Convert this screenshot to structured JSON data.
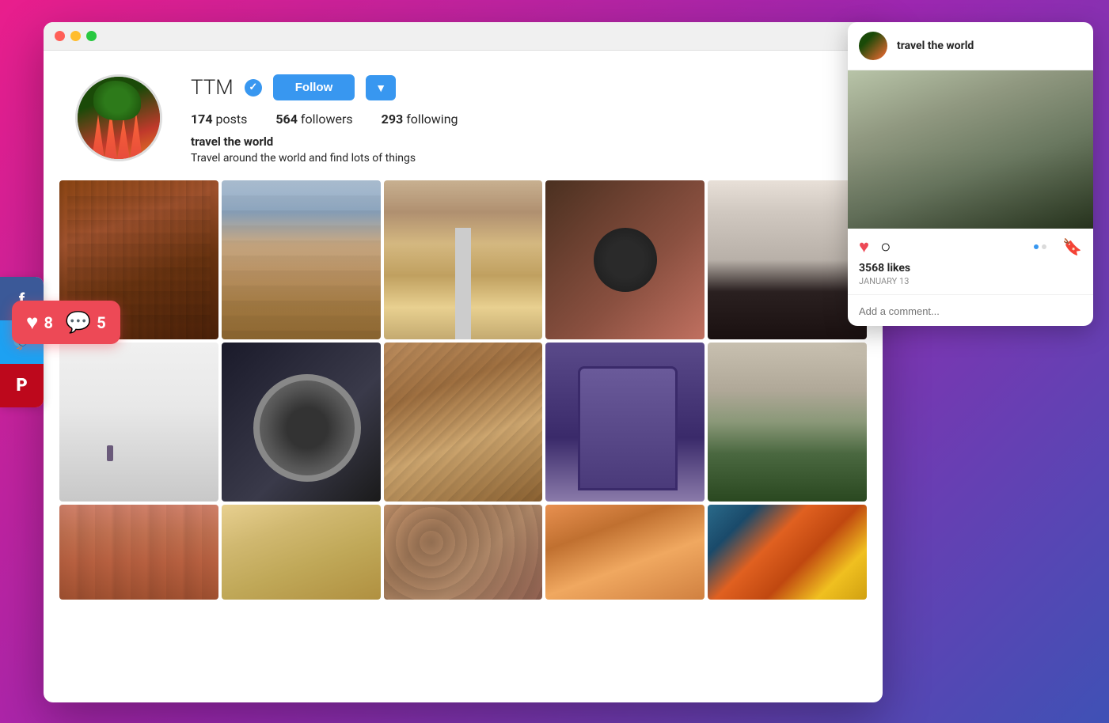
{
  "browser": {
    "dots": [
      "red",
      "yellow",
      "green"
    ]
  },
  "profile": {
    "username": "TTM",
    "verified": true,
    "follow_label": "Follow",
    "stats": {
      "posts_count": "174",
      "posts_label": "posts",
      "followers_count": "564",
      "followers_label": "followers",
      "following_count": "293",
      "following_label": "following"
    },
    "name": "travel the world",
    "bio": "Travel around the world and find lots of things"
  },
  "posts": {
    "grid": [
      [
        {
          "id": "p1",
          "liked": true,
          "img_class": "img-building-rust"
        },
        {
          "id": "p2",
          "liked": true,
          "img_class": "img-building-old"
        },
        {
          "id": "p3",
          "liked": false,
          "img_class": "img-road"
        },
        {
          "id": "p4",
          "liked": false,
          "img_class": "img-camera"
        },
        {
          "id": "p5",
          "liked": false,
          "img_class": "img-woman-hat"
        }
      ],
      [
        {
          "id": "p6",
          "liked": true,
          "img_class": "img-hiker"
        },
        {
          "id": "p7",
          "liked": false,
          "img_class": "img-wheel"
        },
        {
          "id": "p8",
          "liked": false,
          "img_class": "img-stairs"
        },
        {
          "id": "p9",
          "liked": false,
          "img_class": "img-door"
        },
        {
          "id": "p10",
          "liked": false,
          "img_class": "img-forest2"
        }
      ],
      [
        {
          "id": "p11",
          "liked": false,
          "img_class": "img-canyon-red"
        },
        {
          "id": "p12",
          "liked": false,
          "img_class": "img-sand"
        },
        {
          "id": "p13",
          "liked": false,
          "img_class": "img-stone"
        },
        {
          "id": "p14",
          "liked": false,
          "img_class": "img-canyon-orange"
        },
        {
          "id": "p15",
          "liked": false,
          "img_class": "img-colorful"
        }
      ]
    ]
  },
  "notification": {
    "likes": "8",
    "comments": "5"
  },
  "social": {
    "facebook_label": "f",
    "twitter_label": "🐦",
    "pinterest_label": "P"
  },
  "story_card": {
    "username": "travel the world",
    "likes": "3568 likes",
    "date": "JANUARY 13",
    "comment_placeholder": "Add a comment...",
    "dot1": "",
    "dot2": ""
  }
}
